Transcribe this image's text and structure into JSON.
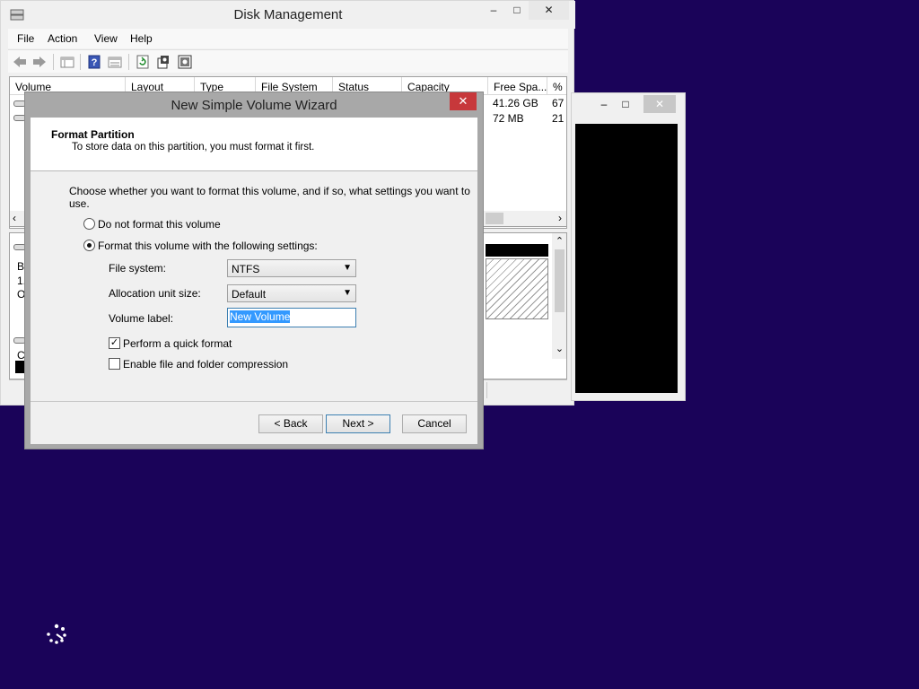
{
  "disk_management": {
    "title": "Disk Management",
    "menu": [
      "File",
      "Action",
      "View",
      "Help"
    ],
    "window_controls": {
      "minimize": "–",
      "maximize": "□",
      "close": "✕"
    },
    "toolbar_icons": [
      "back-arrow-icon",
      "forward-arrow-icon",
      "console-tree-icon",
      "help-icon",
      "properties-icon",
      "refresh-icon",
      "settings-icon",
      "rescan-disks-icon"
    ],
    "columns": [
      "Volume",
      "Layout",
      "Type",
      "File System",
      "Status",
      "Capacity",
      "Free Spa...",
      "% F"
    ],
    "rows": [
      {
        "free_space": "41.26 GB",
        "percent_free": "67"
      },
      {
        "free_space": "72 MB",
        "percent_free": "21"
      }
    ],
    "disk_labels": [
      "B",
      "1.",
      "O"
    ],
    "disk_label_2": "C"
  },
  "console": {
    "controls": {
      "minimize": "–",
      "maximize": "□",
      "close": "✕"
    }
  },
  "wizard": {
    "title": "New Simple Volume Wizard",
    "close": "✕",
    "header_title": "Format Partition",
    "header_subtitle": "To store data on this partition, you must format it first.",
    "instruction": "Choose whether you want to format this volume, and if so, what settings you want to use.",
    "radio_no_format": "Do not format this volume",
    "radio_format": "Format this volume with the following settings:",
    "selected_option": "format",
    "file_system_label": "File system:",
    "file_system_value": "NTFS",
    "allocation_label": "Allocation unit size:",
    "allocation_value": "Default",
    "volume_label_label": "Volume label:",
    "volume_label_value": "New Volume",
    "quick_format_label": "Perform a quick format",
    "quick_format_checked": true,
    "compression_label": "Enable file and folder compression",
    "compression_checked": false,
    "back_button": "< Back",
    "next_button": "Next >",
    "cancel_button": "Cancel"
  }
}
